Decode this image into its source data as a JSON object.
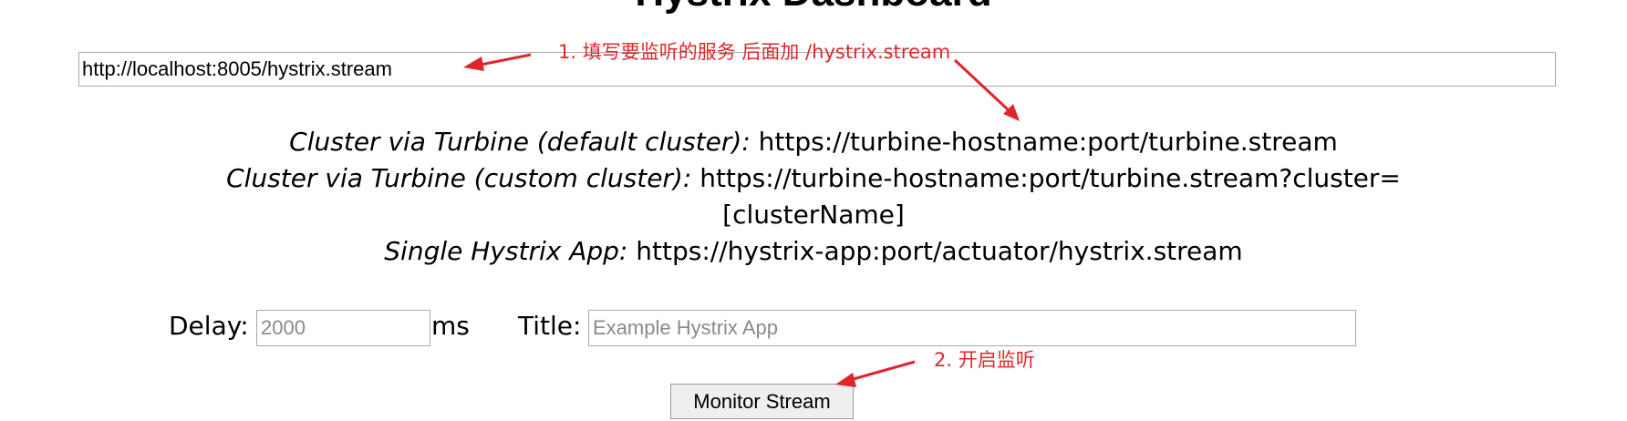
{
  "page": {
    "title": "Hystrix Dashboard"
  },
  "stream_input": {
    "value": "http://localhost:8005/hystrix.stream"
  },
  "examples": [
    {
      "label": "Cluster via Turbine (default cluster):",
      "url": "https://turbine-hostname:port/turbine.stream"
    },
    {
      "label": "Cluster via Turbine (custom cluster):",
      "url": "https://turbine-hostname:port/turbine.stream?cluster=[clusterName]"
    },
    {
      "label": "Single Hystrix App:",
      "url": "https://hystrix-app:port/actuator/hystrix.stream"
    }
  ],
  "form": {
    "delay_label": "Delay:",
    "delay_placeholder": "2000",
    "delay_unit": "ms",
    "title_label": "Title:",
    "title_placeholder": "Example Hystrix App",
    "monitor_button": "Monitor Stream"
  },
  "annotations": {
    "step1": "1. 填写要监听的服务 后面加 /hystrix.stream",
    "step2": "2. 开启监听",
    "color": "#e0262c"
  }
}
